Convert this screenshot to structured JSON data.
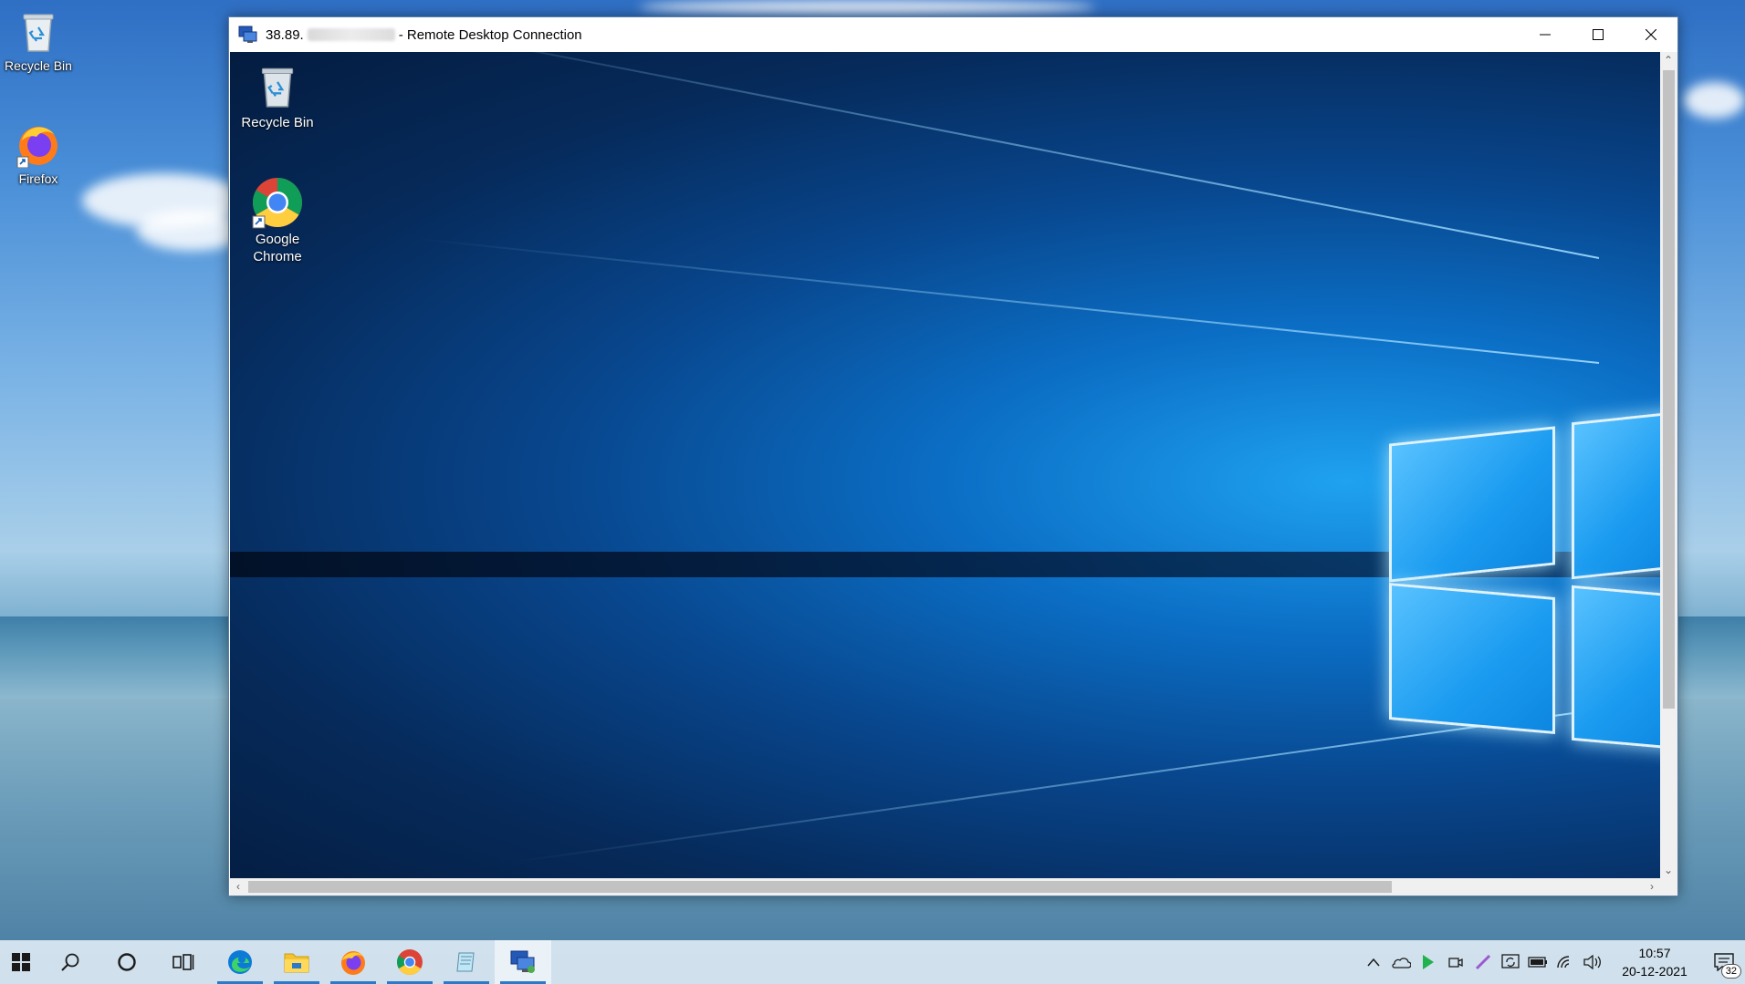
{
  "host_desktop": {
    "icons": [
      {
        "label": "Recycle Bin",
        "icon": "recycle-bin-icon"
      },
      {
        "label": "Firefox",
        "icon": "firefox-icon"
      }
    ]
  },
  "rdp_window": {
    "title_prefix": "38.89.",
    "title_suffix": "- Remote Desktop Connection",
    "controls": {
      "minimize": "minimize-icon",
      "maximize": "maximize-icon",
      "close": "close-icon"
    },
    "remote_icons": [
      {
        "label": "Recycle Bin",
        "icon": "recycle-bin-icon"
      },
      {
        "label_line1": "Google",
        "label_line2": "Chrome",
        "icon": "chrome-icon"
      }
    ]
  },
  "taskbar": {
    "apps": [
      "start-icon",
      "search-icon",
      "cortana-icon",
      "task-view-icon",
      "edge-icon",
      "file-explorer-icon",
      "firefox-icon",
      "chrome-icon",
      "notepad-icon",
      "remote-desktop-icon"
    ],
    "tray": [
      "chevron-up-icon",
      "onedrive-icon",
      "play-icon",
      "meet-now-icon",
      "pen-icon",
      "sync-icon",
      "battery-icon",
      "wifi-icon",
      "volume-icon"
    ],
    "time": "10:57",
    "date": "20-12-2021",
    "notification_count": "32"
  },
  "colors": {
    "accent": "#2b79c8",
    "remote_glow": "#1fa2f0"
  }
}
